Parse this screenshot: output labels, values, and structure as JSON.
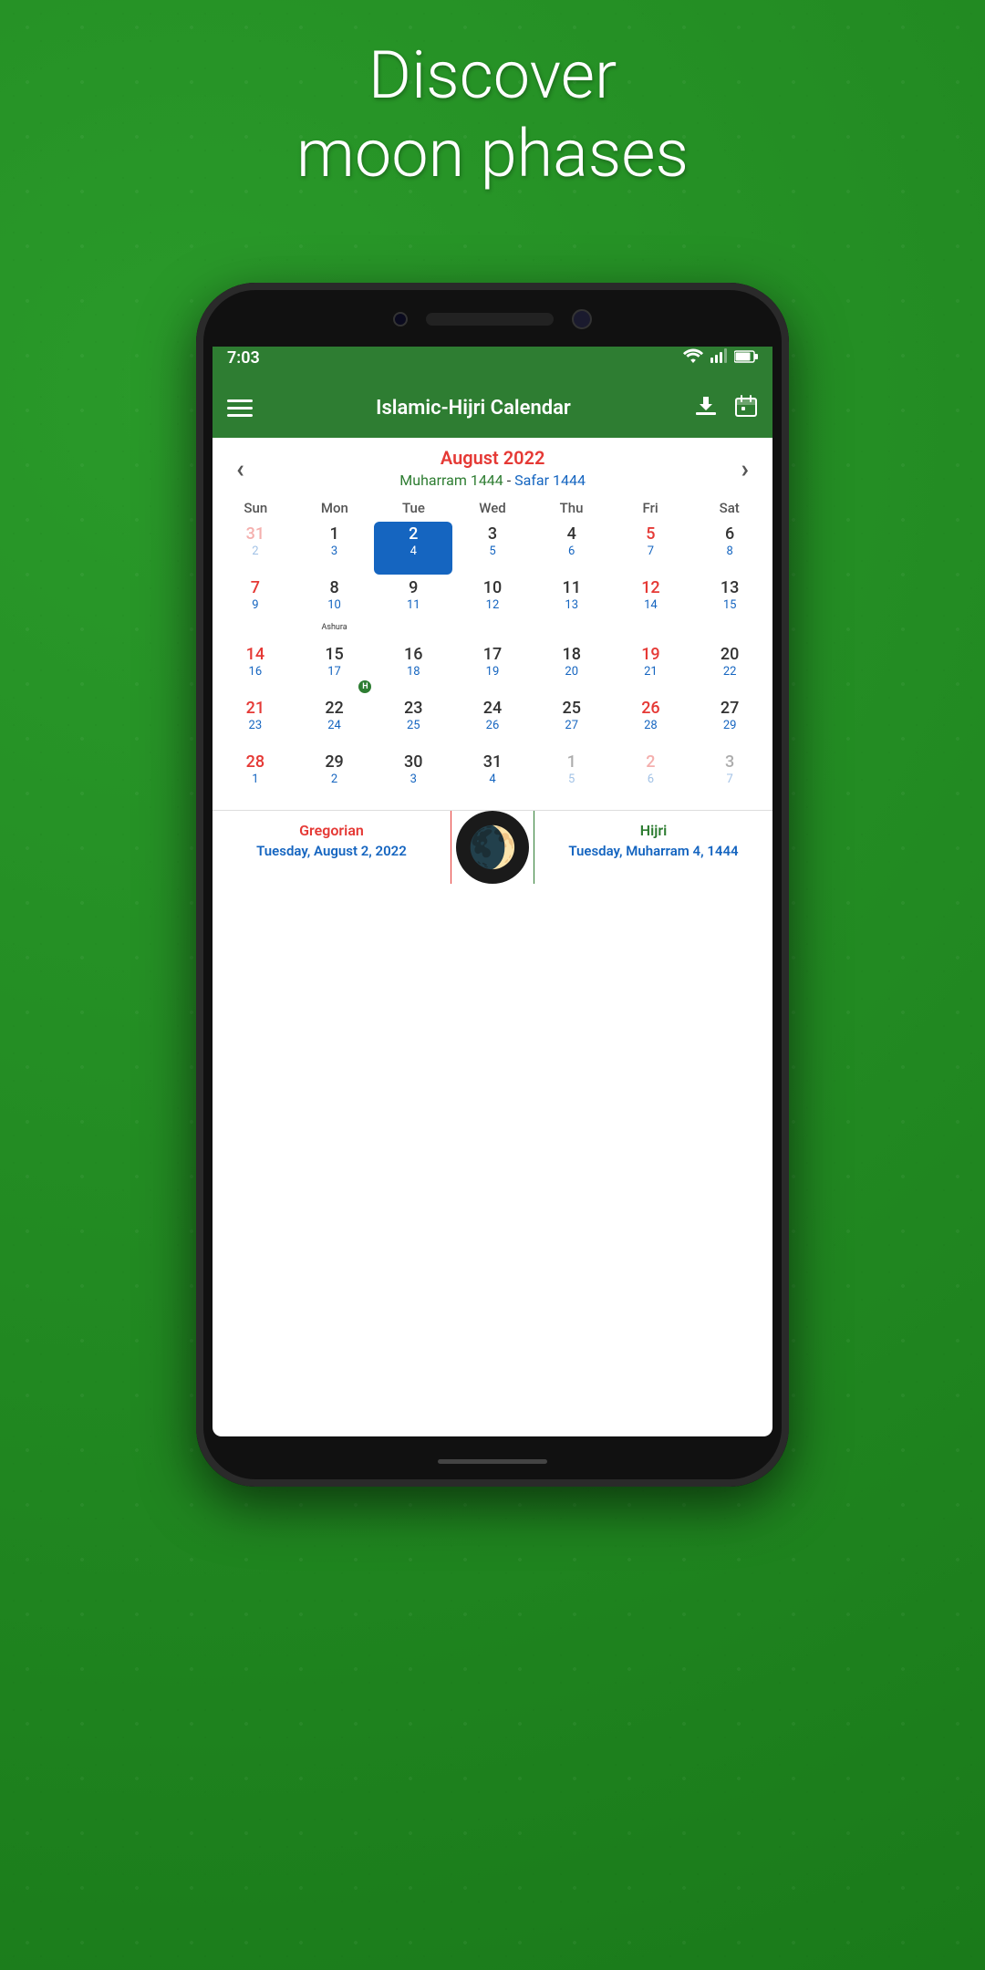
{
  "hero": {
    "line1": "Discover",
    "line2": "moon phases"
  },
  "status_bar": {
    "time": "7:03"
  },
  "app_bar": {
    "title": "Islamic-Hijri Calendar"
  },
  "calendar": {
    "gregorian_month": "August 2022",
    "hijri_part1": "Muharram 1444",
    "hijri_dash": " - ",
    "hijri_part2": "Safar 1444",
    "day_headers": [
      "Sun",
      "Mon",
      "Tue",
      "Wed",
      "Thu",
      "Fri",
      "Sat"
    ],
    "weeks": [
      [
        {
          "greg": "31",
          "hijri": "2",
          "col": "col-sun",
          "other": true
        },
        {
          "greg": "1",
          "hijri": "3",
          "col": "col-mon"
        },
        {
          "greg": "2",
          "hijri": "4",
          "col": "col-tue",
          "selected": true
        },
        {
          "greg": "3",
          "hijri": "5",
          "col": "col-wed"
        },
        {
          "greg": "4",
          "hijri": "6",
          "col": "col-thu"
        },
        {
          "greg": "5",
          "hijri": "7",
          "col": "col-fri"
        },
        {
          "greg": "6",
          "hijri": "8",
          "col": "col-sat"
        }
      ],
      [
        {
          "greg": "7",
          "hijri": "9",
          "col": "col-sun"
        },
        {
          "greg": "8",
          "hijri": "10",
          "col": "col-mon",
          "ashura": true
        },
        {
          "greg": "9",
          "hijri": "11",
          "col": "col-tue"
        },
        {
          "greg": "10",
          "hijri": "12",
          "col": "col-wed"
        },
        {
          "greg": "11",
          "hijri": "13",
          "col": "col-thu"
        },
        {
          "greg": "12",
          "hijri": "14",
          "col": "col-fri"
        },
        {
          "greg": "13",
          "hijri": "15",
          "col": "col-sat"
        }
      ],
      [
        {
          "greg": "14",
          "hijri": "16",
          "col": "col-sun"
        },
        {
          "greg": "15",
          "hijri": "17",
          "col": "col-mon",
          "holiday": "H"
        },
        {
          "greg": "16",
          "hijri": "18",
          "col": "col-tue"
        },
        {
          "greg": "17",
          "hijri": "19",
          "col": "col-wed"
        },
        {
          "greg": "18",
          "hijri": "20",
          "col": "col-thu"
        },
        {
          "greg": "19",
          "hijri": "21",
          "col": "col-fri"
        },
        {
          "greg": "20",
          "hijri": "22",
          "col": "col-sat"
        }
      ],
      [
        {
          "greg": "21",
          "hijri": "23",
          "col": "col-sun"
        },
        {
          "greg": "22",
          "hijri": "24",
          "col": "col-mon"
        },
        {
          "greg": "23",
          "hijri": "25",
          "col": "col-tue"
        },
        {
          "greg": "24",
          "hijri": "26",
          "col": "col-wed"
        },
        {
          "greg": "25",
          "hijri": "27",
          "col": "col-thu"
        },
        {
          "greg": "26",
          "hijri": "28",
          "col": "col-fri"
        },
        {
          "greg": "27",
          "hijri": "29",
          "col": "col-sat"
        }
      ],
      [
        {
          "greg": "28",
          "hijri": "1",
          "col": "col-sun"
        },
        {
          "greg": "29",
          "hijri": "2",
          "col": "col-mon"
        },
        {
          "greg": "30",
          "hijri": "3",
          "col": "col-tue"
        },
        {
          "greg": "31",
          "hijri": "4",
          "col": "col-wed"
        },
        {
          "greg": "1",
          "hijri": "5",
          "col": "col-thu",
          "other": true
        },
        {
          "greg": "2",
          "hijri": "6",
          "col": "col-fri",
          "other": true
        },
        {
          "greg": "3",
          "hijri": "7",
          "col": "col-sat",
          "other": true
        }
      ]
    ]
  },
  "bottom_panel": {
    "gregorian_label": "Gregorian",
    "gregorian_date": "Tuesday, August 2, 2022",
    "hijri_label": "Hijri",
    "hijri_date": "Tuesday, Muharram 4, 1444",
    "moon_symbol": "🌒"
  }
}
